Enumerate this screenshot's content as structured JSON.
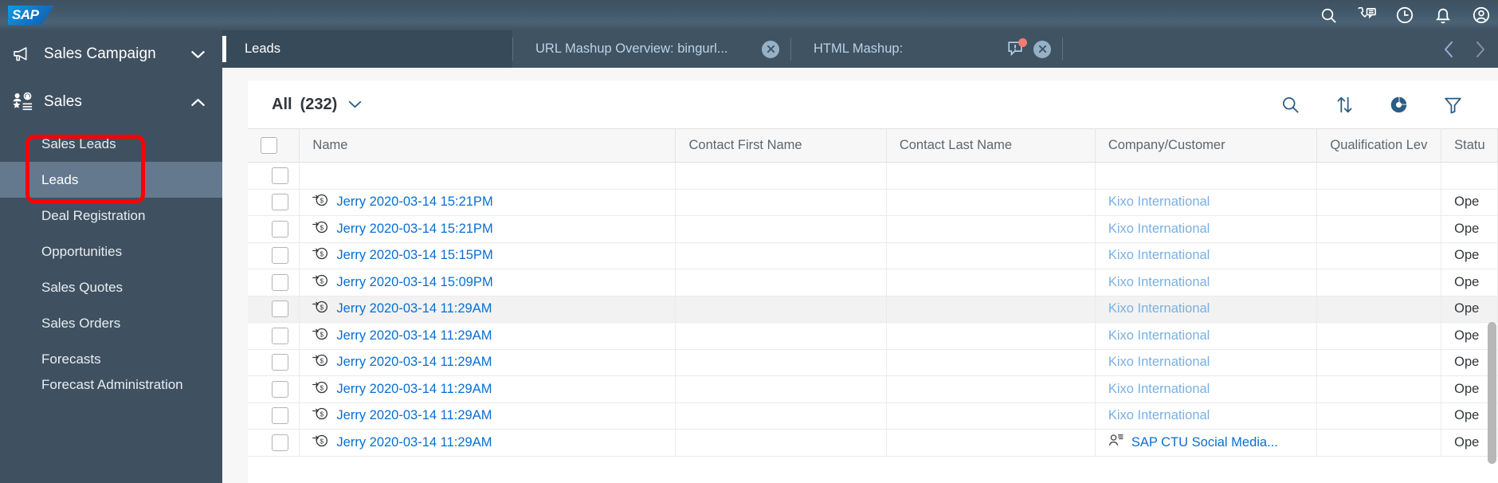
{
  "shell": {
    "logo_text": "SAP",
    "icons": [
      {
        "name": "search-icon",
        "label": "Search"
      },
      {
        "name": "phone-chat-icon",
        "label": "Contact"
      },
      {
        "name": "recent-history-icon",
        "label": "Recent Activity"
      },
      {
        "name": "notifications-bell-icon",
        "label": "Notifications"
      },
      {
        "name": "user-avatar-icon",
        "label": "User Profile"
      }
    ]
  },
  "sidebar": {
    "groups": [
      {
        "label": "Sales Campaign",
        "icon": "megaphone-icon",
        "expanded": false,
        "chevron": "chevron-down-icon"
      },
      {
        "label": "Sales",
        "icon": "sales-person-icon",
        "expanded": true,
        "chevron": "chevron-up-icon"
      }
    ],
    "items": [
      {
        "label": "Sales Leads",
        "active": false
      },
      {
        "label": "Leads",
        "active": true
      },
      {
        "label": "Deal Registration",
        "active": false
      },
      {
        "label": "Opportunities",
        "active": false
      },
      {
        "label": "Sales Quotes",
        "active": false
      },
      {
        "label": "Sales Orders",
        "active": false
      },
      {
        "label": "Forecasts",
        "active": false
      },
      {
        "label": "Forecast Administration",
        "active": false
      }
    ]
  },
  "tabs": [
    {
      "title": "Leads",
      "active": true,
      "closable": false,
      "warning": false
    },
    {
      "title": "URL Mashup Overview: bingurl...",
      "active": false,
      "closable": true,
      "warning": false
    },
    {
      "title": "HTML Mashup:",
      "active": false,
      "closable": true,
      "warning": true
    }
  ],
  "tab_pager": {
    "prev_icon": "chevron-left-icon",
    "next_icon": "chevron-right-icon"
  },
  "toolbar": {
    "view_name": "All",
    "view_count": "(232)",
    "dropdown_icon": "chevron-down-icon",
    "actions": [
      {
        "name": "search-icon",
        "label": "Search"
      },
      {
        "name": "sort-icon",
        "label": "Sort"
      },
      {
        "name": "chart-donut-icon",
        "label": "Chart View"
      },
      {
        "name": "filter-funnel-icon",
        "label": "Filter"
      }
    ]
  },
  "table": {
    "columns": [
      {
        "key": "checkbox",
        "label": ""
      },
      {
        "key": "name",
        "label": "Name"
      },
      {
        "key": "contact_first_name",
        "label": "Contact First Name"
      },
      {
        "key": "contact_last_name",
        "label": "Contact Last Name"
      },
      {
        "key": "company_customer",
        "label": "Company/Customer"
      },
      {
        "key": "qualification_level",
        "label": "Qualification Lev"
      },
      {
        "key": "status",
        "label": "Statu"
      }
    ],
    "rows": [
      {
        "name": "",
        "contact_first_name": "",
        "contact_last_name": "",
        "company_customer": "",
        "company_icon": "",
        "qualification_level": "",
        "status": "",
        "selected": false,
        "partial": true
      },
      {
        "name": "Jerry 2020-03-14 15:21PM",
        "contact_first_name": "",
        "contact_last_name": "",
        "company_customer": "Kixo International",
        "company_icon": "",
        "qualification_level": "",
        "status": "Ope",
        "selected": false
      },
      {
        "name": "Jerry 2020-03-14 15:21PM",
        "contact_first_name": "",
        "contact_last_name": "",
        "company_customer": "Kixo International",
        "company_icon": "",
        "qualification_level": "",
        "status": "Ope",
        "selected": false
      },
      {
        "name": "Jerry 2020-03-14 15:15PM",
        "contact_first_name": "",
        "contact_last_name": "",
        "company_customer": "Kixo International",
        "company_icon": "",
        "qualification_level": "",
        "status": "Ope",
        "selected": false
      },
      {
        "name": "Jerry 2020-03-14 15:09PM",
        "contact_first_name": "",
        "contact_last_name": "",
        "company_customer": "Kixo International",
        "company_icon": "",
        "qualification_level": "",
        "status": "Ope",
        "selected": false
      },
      {
        "name": "Jerry 2020-03-14 11:29AM",
        "contact_first_name": "",
        "contact_last_name": "",
        "company_customer": "Kixo International",
        "company_icon": "",
        "qualification_level": "",
        "status": "Ope",
        "selected": true
      },
      {
        "name": "Jerry 2020-03-14 11:29AM",
        "contact_first_name": "",
        "contact_last_name": "",
        "company_customer": "Kixo International",
        "company_icon": "",
        "qualification_level": "",
        "status": "Ope",
        "selected": false
      },
      {
        "name": "Jerry 2020-03-14 11:29AM",
        "contact_first_name": "",
        "contact_last_name": "",
        "company_customer": "Kixo International",
        "company_icon": "",
        "qualification_level": "",
        "status": "Ope",
        "selected": false
      },
      {
        "name": "Jerry 2020-03-14 11:29AM",
        "contact_first_name": "",
        "contact_last_name": "",
        "company_customer": "Kixo International",
        "company_icon": "",
        "qualification_level": "",
        "status": "Ope",
        "selected": false
      },
      {
        "name": "Jerry 2020-03-14 11:29AM",
        "contact_first_name": "",
        "contact_last_name": "",
        "company_customer": "Kixo International",
        "company_icon": "",
        "qualification_level": "",
        "status": "Ope",
        "selected": false
      },
      {
        "name": "Jerry 2020-03-14 11:29AM",
        "contact_first_name": "",
        "contact_last_name": "",
        "company_customer": "SAP CTU Social Media...",
        "company_icon": "contact-person-icon",
        "qualification_level": "",
        "status": "Ope",
        "selected": false
      }
    ],
    "row_icon": "lead-money-icon"
  },
  "colors": {
    "shell_bg": "#41596b",
    "sidebar_bg": "#3f5161",
    "sidebar_active": "#64798e",
    "tab_bg": "#3f5363",
    "tab_active": "#374a59",
    "link": "#0a6ed1",
    "link_muted": "#7bb0e0",
    "highlight_box": "#fe0000",
    "warning_dot": "#f37b72"
  }
}
